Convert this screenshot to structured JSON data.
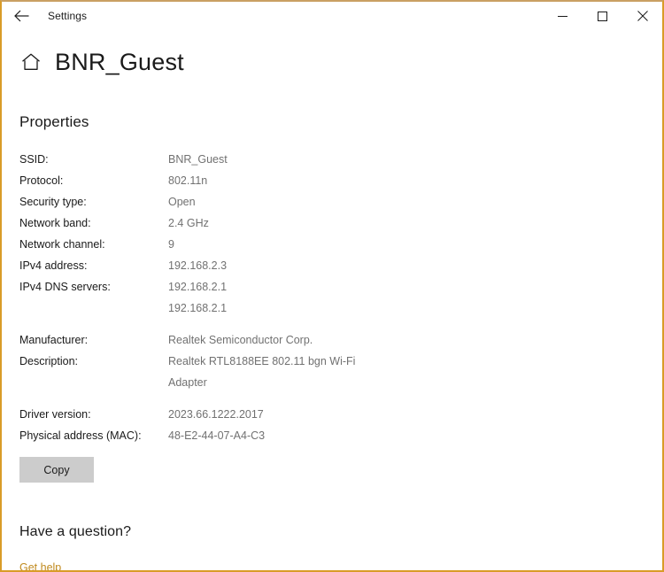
{
  "window": {
    "border_color": "#d99c28",
    "titlebar": {
      "back_label": "Back",
      "app_title": "Settings",
      "minimize_label": "Minimize",
      "maximize_label": "Maximize",
      "close_label": "Close"
    }
  },
  "header": {
    "home_icon": "home-icon",
    "title": "BNR_Guest"
  },
  "main": {
    "section_heading": "Properties",
    "properties": [
      {
        "label": "SSID:",
        "values": [
          "BNR_Guest"
        ],
        "spaced": false
      },
      {
        "label": "Protocol:",
        "values": [
          "802.11n"
        ],
        "spaced": false
      },
      {
        "label": "Security type:",
        "values": [
          "Open"
        ],
        "spaced": false
      },
      {
        "label": "Network band:",
        "values": [
          "2.4 GHz"
        ],
        "spaced": false
      },
      {
        "label": "Network channel:",
        "values": [
          "9"
        ],
        "spaced": false
      },
      {
        "label": "IPv4 address:",
        "values": [
          "192.168.2.3"
        ],
        "spaced": false
      },
      {
        "label": "IPv4 DNS servers:",
        "values": [
          "192.168.2.1",
          "192.168.2.1"
        ],
        "spaced": false
      },
      {
        "label": "Manufacturer:",
        "values": [
          "Realtek Semiconductor Corp."
        ],
        "spaced": true
      },
      {
        "label": "Description:",
        "values": [
          "Realtek RTL8188EE 802.11 bgn Wi-Fi",
          "Adapter"
        ],
        "spaced": false
      },
      {
        "label": "Driver version:",
        "values": [
          "2023.66.1222.2017"
        ],
        "spaced": true
      },
      {
        "label": "Physical address (MAC):",
        "values": [
          "48-E2-44-07-A4-C3"
        ],
        "spaced": false
      }
    ],
    "copy_button": "Copy"
  },
  "help": {
    "heading": "Have a question?",
    "link": "Get help",
    "link_color": "#c08a1e"
  }
}
